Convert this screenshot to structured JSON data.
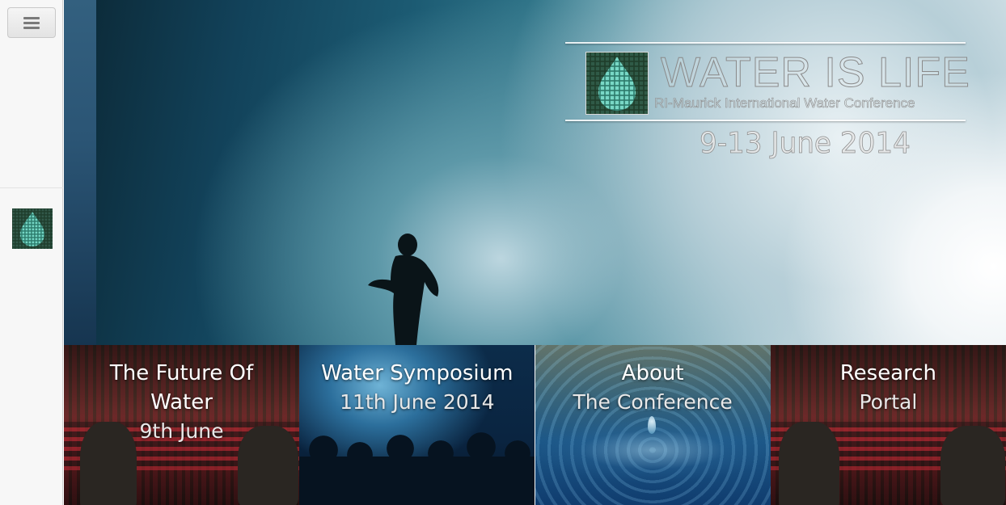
{
  "sidebar": {
    "menu_icon": "hamburger-menu-icon",
    "logo_icon": "water-drop-grid-logo"
  },
  "hero": {
    "title": "WATER IS LIFE",
    "subtitle": "RI-Maurick International Water Conference",
    "date": "9-13 June 2014"
  },
  "tiles": [
    {
      "title": "The Future Of Water",
      "subtitle": "9th June"
    },
    {
      "title": "Water Symposium",
      "subtitle": "11th June 2014"
    },
    {
      "title": "About",
      "subtitle": "The Conference"
    },
    {
      "title": "Research",
      "subtitle": "Portal"
    }
  ],
  "colors": {
    "logo_green": "#1e3d2b",
    "logo_drop": "#6fd1c0",
    "sidebar_bg": "#f7f7f7"
  }
}
